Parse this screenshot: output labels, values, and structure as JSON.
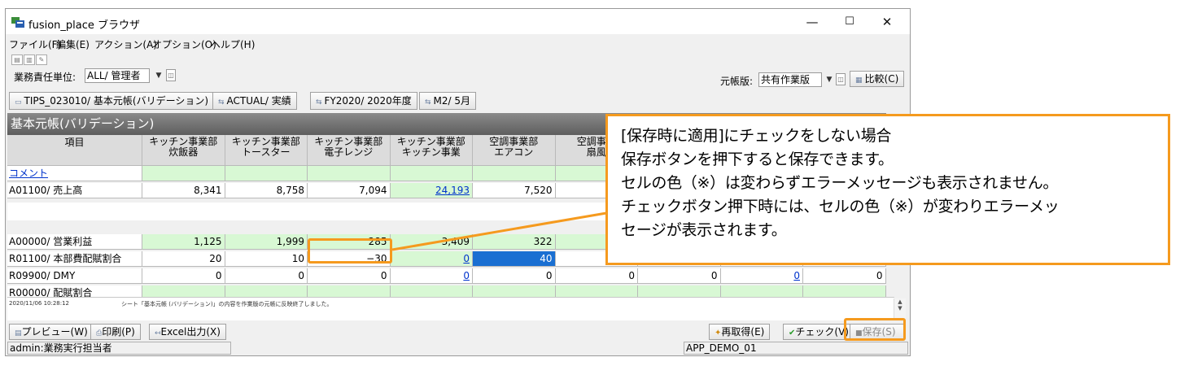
{
  "window": {
    "title": "fusion_place ブラウザ",
    "controls": {
      "minimize": "—",
      "maximize": "☐",
      "close": "✕"
    }
  },
  "menu": [
    "ファイル(F)",
    "編集(E)",
    "アクション(A)",
    "オプション(O)",
    "ヘルプ(H)"
  ],
  "filter": {
    "label": "業務責任単位:",
    "value": "ALL/ 管理者",
    "ledger_label": "元帳版:",
    "ledger_value": "共有作業版",
    "compare_button": "比較(C)"
  },
  "toolbar_tabs": [
    "TIPS_023010/ 基本元帳(バリデーション)",
    "ACTUAL/ 実績",
    "FY2020/ 2020年度",
    "M2/ 5月"
  ],
  "sheet_title": "基本元帳(バリデーション)",
  "table": {
    "item_header": "項目",
    "columns": [
      [
        "キッチン事業部",
        "炊飯器"
      ],
      [
        "キッチン事業部",
        "トースター"
      ],
      [
        "キッチン事業部",
        "電子レンジ"
      ],
      [
        "キッチン事業部",
        "キッチン事業"
      ],
      [
        "空調事業部",
        "エアコン"
      ],
      [
        "空調事業",
        "扇風"
      ]
    ],
    "top_rows": [
      {
        "label": "コメント",
        "cells": [
          "",
          "",
          "",
          "",
          "",
          "",
          "",
          "",
          ""
        ]
      },
      {
        "label": "A01100/ 売上高",
        "cells": [
          "8,341",
          "8,758",
          "7,094",
          "24,193",
          "7,520",
          "",
          "",
          "",
          ""
        ]
      }
    ],
    "bottom_rows": [
      {
        "label": "A00000/ 営業利益",
        "cells": [
          "1,125",
          "1,999",
          "285",
          "3,409",
          "322",
          "",
          "",
          "",
          ""
        ]
      },
      {
        "label": "R01100/ 本部費配賦割合",
        "cells": [
          "20",
          "10",
          "−30",
          "0",
          "40",
          "",
          "",
          "",
          ""
        ]
      },
      {
        "label": "R09900/ DMY",
        "cells": [
          "0",
          "0",
          "0",
          "0",
          "0",
          "0",
          "0",
          "0",
          "0"
        ]
      },
      {
        "label": "R00000/ 配賦割合",
        "cells": [
          "",
          "",
          "",
          "",
          "",
          "",
          "",
          "",
          ""
        ]
      }
    ]
  },
  "log": {
    "timestamp": "2020/11/06 10:28:12",
    "message": "シート「基本元帳 (バリデーション)」の内容を作業版の元帳に反映終了しました。"
  },
  "bottom_buttons": {
    "preview": "プレビュー(W)",
    "print": "印刷(P)",
    "excel": "Excel出力(X)",
    "refetch": "再取得(E)",
    "check": "チェック(V)",
    "save": "保存(S)"
  },
  "status": {
    "left": "admin:業務実行担当者",
    "right": "APP_DEMO_01"
  },
  "callout": {
    "lines": [
      "[保存時に適用]にチェックをしない場合",
      "保存ボタンを押下すると保存できます。",
      "セルの色（※）は変わらずエラーメッセージも表示されません。",
      "チェックボタン押下時には、セルの色（※）が変わりエラーメッ",
      "セージが表示されます。"
    ],
    "color": "#f59a1e"
  },
  "colors": {
    "green_cell": "#d8f8d4",
    "selected_cell": "#1a6fd2",
    "header_gray": "#dcdcdc"
  }
}
